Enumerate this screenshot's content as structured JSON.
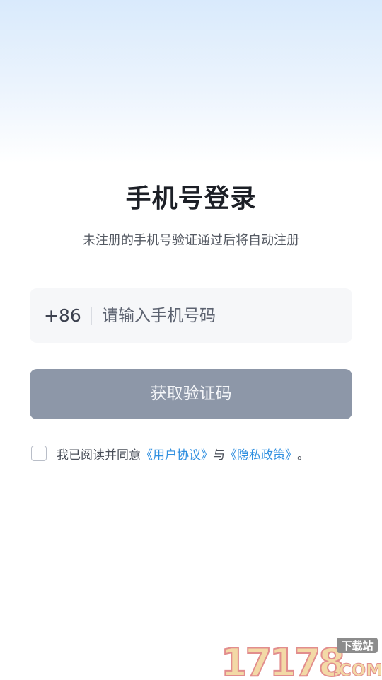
{
  "title": "手机号登录",
  "subtitle": "未注册的手机号验证通过后将自动注册",
  "phone": {
    "country_code": "+86",
    "placeholder": "请输入手机号码",
    "value": ""
  },
  "code_button": "获取验证码",
  "agreement": {
    "prefix": "我已阅读并同意",
    "user_agreement": "《用户协议》",
    "conjunction": "与",
    "privacy_policy": "《隐私政策》",
    "suffix": "。",
    "checked": false
  },
  "watermark": {
    "number": "17178",
    "top_label": "下载站",
    "bottom_label": ".COM"
  },
  "colors": {
    "button_disabled": "#8d97a8",
    "link": "#2f8fe0",
    "input_bg": "#f6f7f9"
  }
}
